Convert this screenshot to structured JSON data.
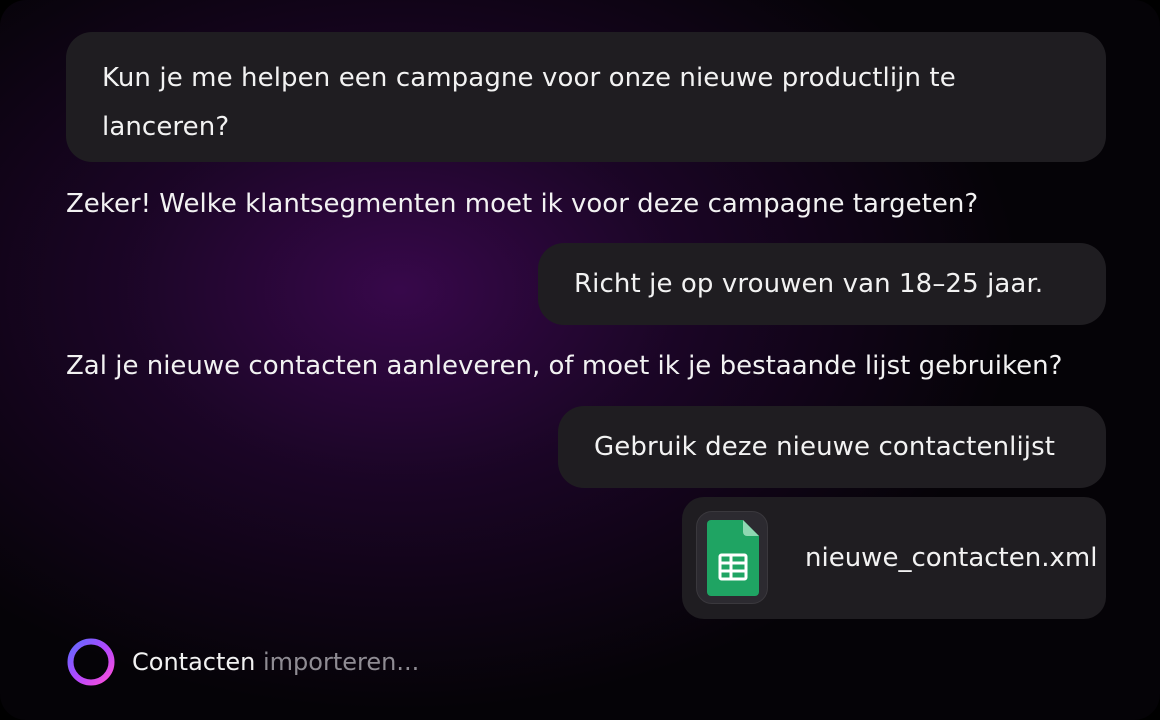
{
  "chat": {
    "messages": [
      {
        "role": "user",
        "text": "Kun je me helpen een campagne voor onze nieuwe productlijn te lanceren?"
      },
      {
        "role": "assistant",
        "text": "Zeker! Welke klantsegmenten moet ik voor deze campagne targeten?"
      },
      {
        "role": "user",
        "text": "Richt je op vrouwen van 18–25 jaar."
      },
      {
        "role": "assistant",
        "text": "Zal je nieuwe contacten aanleveren, of moet ik je bestaande lijst gebruiken?"
      },
      {
        "role": "user",
        "text": "Gebruik deze nieuwe contactenlijst"
      }
    ],
    "attachment": {
      "filename": "nieuwe_contacten.xml",
      "icon": "spreadsheet-file-icon",
      "icon_color": "#1fa463"
    }
  },
  "status": {
    "text_strong": "Contacten",
    "text_dim": " importeren...",
    "icon": "loading-ring-icon"
  },
  "colors": {
    "bubble": "#1f1d21",
    "background_glow": "#3a084e",
    "ring_gradient": [
      "#6a5cff",
      "#b048ff",
      "#ff4fd8"
    ]
  }
}
